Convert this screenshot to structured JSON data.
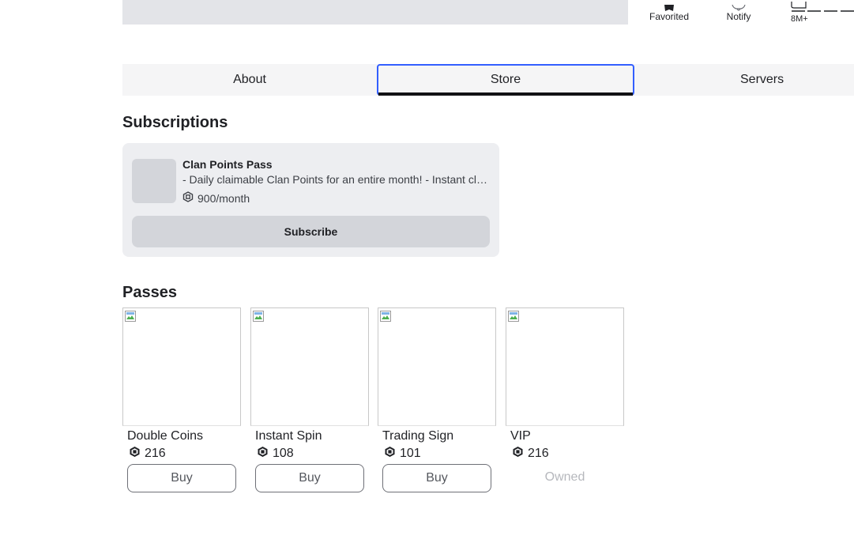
{
  "header": {
    "stats": [
      {
        "label": "Favorited",
        "icon": "star-icon"
      },
      {
        "label": "Notify",
        "icon": "bell-icon"
      },
      {
        "label": "8M+",
        "icon": "visits-icon"
      }
    ]
  },
  "tabs": [
    {
      "label": "About",
      "active": false
    },
    {
      "label": "Store",
      "active": true
    },
    {
      "label": "Servers",
      "active": false
    }
  ],
  "subscriptions": {
    "heading": "Subscriptions",
    "items": [
      {
        "name": "Clan Points Pass",
        "description": "- Daily claimable Clan Points for an entire month! - Instant claim of Clan Points upon subscribing",
        "price": "900/month",
        "price_icon": "robux-icon",
        "button_label": "Subscribe"
      }
    ]
  },
  "passes": {
    "heading": "Passes",
    "items": [
      {
        "name": "Double Coins",
        "price": "216",
        "action": "Buy",
        "owned": false
      },
      {
        "name": "Instant Spin",
        "price": "108",
        "action": "Buy",
        "owned": false
      },
      {
        "name": "Trading Sign",
        "price": "101",
        "action": "Buy",
        "owned": false
      },
      {
        "name": "VIP",
        "price": "216",
        "action": "Owned",
        "owned": true
      }
    ]
  },
  "colors": {
    "accent": "#335fff",
    "tab_underline": "#121215",
    "card_bg": "#edeef1",
    "button_bg": "#d3d5da",
    "owned_text": "#b6b8bd"
  }
}
